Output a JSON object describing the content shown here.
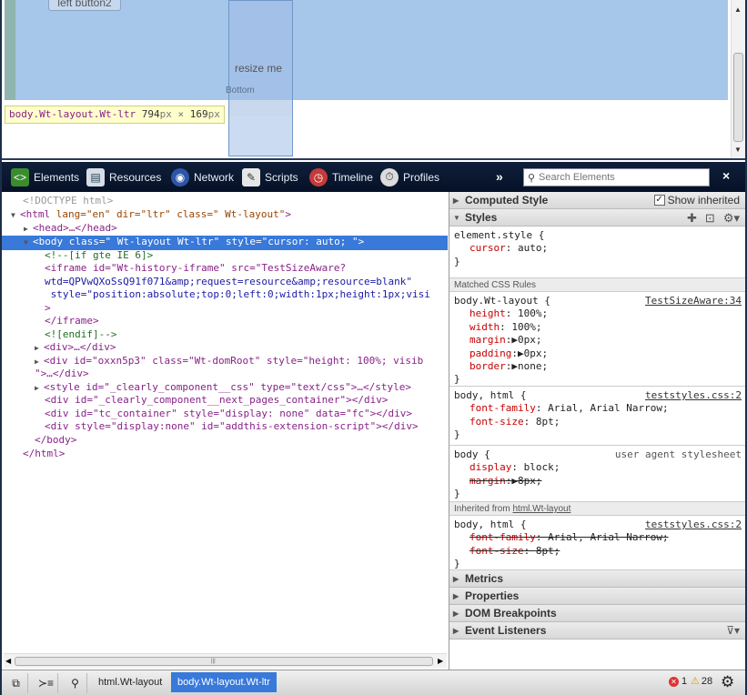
{
  "preview": {
    "button_label": "left button2",
    "resize_label": "resize me",
    "bottom_label": "Bottom",
    "tooltip": {
      "selector": "body.Wt-layout.Wt-ltr",
      "width": "794",
      "unit1": "px",
      "times": "×",
      "height": "169",
      "unit2": "px"
    }
  },
  "toolbar": {
    "tabs": [
      {
        "label": "Elements",
        "icon": "elements-icon"
      },
      {
        "label": "Resources",
        "icon": "resources-icon"
      },
      {
        "label": "Network",
        "icon": "network-icon"
      },
      {
        "label": "Scripts",
        "icon": "scripts-icon"
      },
      {
        "label": "Timeline",
        "icon": "timeline-icon"
      },
      {
        "label": "Profiles",
        "icon": "profiles-icon"
      }
    ],
    "more_label": "»",
    "search_placeholder": "Search Elements",
    "close_label": "×"
  },
  "dom": {
    "doctype": "<!DOCTYPE html>",
    "html_open": {
      "tag": "html",
      "attrs": "lang=\"en\" dir=\"ltr\" class=\" Wt-layout\""
    },
    "head": "<head>…</head>",
    "body_sel": "<body class=\" Wt-layout Wt-ltr\" style=\"cursor: auto; \">",
    "lines": [
      "<!--[if gte IE 6]>",
      "<iframe id=\"Wt-history-iframe\" src=\"TestSizeAware?",
      "wtd=QPVwQXoSsQ91f071&amp;request=resource&amp;resource=blank\"",
      " style=\"position:absolute;top:0;left:0;width:1px;height:1px;visi",
      ">",
      "</iframe>",
      "<![endif]-->",
      "<div>…</div>",
      "<div id=\"oxxn5p3\" class=\"Wt-domRoot\" style=\"height: 100%; visib",
      "\">…</div>",
      "<style id=\"_clearly_component__css\" type=\"text/css\">…</style>",
      "<div id=\"_clearly_component__next_pages_container\"></div>",
      "<div id=\"tc_container\" style=\"display: none\" data=\"fc\"></div>",
      "<div style=\"display:none\" id=\"addthis-extension-script\"></div>",
      "</body>",
      "</html>"
    ]
  },
  "side": {
    "computed_style": "Computed Style",
    "show_inherited": "Show inherited",
    "styles": "Styles",
    "element_style": {
      "selector": "element.style {",
      "props": [
        {
          "name": "cursor",
          "value": "auto;"
        }
      ],
      "close": "}"
    },
    "matched_header": "Matched CSS Rules",
    "rule1": {
      "selector": "body.Wt-layout {",
      "source": "TestSizeAware:34",
      "props": [
        {
          "name": "height",
          "value": "100%;"
        },
        {
          "name": "width",
          "value": "100%;"
        },
        {
          "name": "margin",
          "value": "▶0px;"
        },
        {
          "name": "padding",
          "value": "▶0px;"
        },
        {
          "name": "border",
          "value": "▶none;"
        }
      ]
    },
    "rule2": {
      "selector": "body, html {",
      "source": "teststyles.css:2",
      "props": [
        {
          "name": "font-family",
          "value": "Arial, Arial Narrow;"
        },
        {
          "name": "font-size",
          "value": "8pt;"
        }
      ]
    },
    "rule3": {
      "selector": "body {",
      "source": "user agent stylesheet",
      "props": [
        {
          "name": "display",
          "value": "block;"
        },
        {
          "name": "margin",
          "value": "▶8px;"
        }
      ]
    },
    "inherited_header": "Inherited from ",
    "inherited_link": "html.Wt-layout",
    "rule4": {
      "selector": "body, html {",
      "source": "teststyles.css:2",
      "props": [
        {
          "name": "font-family",
          "value": "Arial, Arial Narrow;"
        },
        {
          "name": "font-size",
          "value": "8pt;"
        }
      ]
    },
    "close_brace": "}",
    "sections": [
      "Metrics",
      "Properties",
      "DOM Breakpoints",
      "Event Listeners"
    ]
  },
  "status": {
    "crumbs": [
      "html.Wt-layout",
      "body.Wt-layout.Wt-ltr"
    ],
    "errors": "1",
    "warnings": "28"
  },
  "colors": {
    "selection": "#3879d9",
    "toolbar": "#0f1f3a",
    "highlight": "#a6c6ea"
  }
}
